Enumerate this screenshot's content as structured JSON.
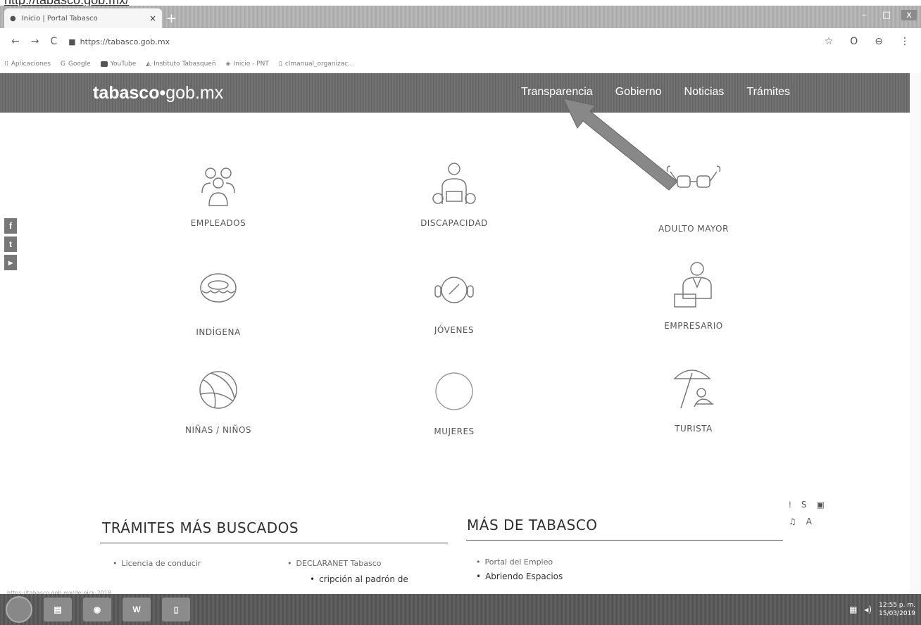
{
  "page_url_caption": "http://tabasco.gob.mx/",
  "browser": {
    "tab_title": "Inicio | Portal Tabasco",
    "new_tab": "+",
    "address": "https://tabasco.gob.mx",
    "bookmarks": [
      "Aplicaciones",
      "Google",
      "YouTube",
      "Instituto Tabasqueñ",
      "Inicio - PNT",
      "clmanual_organizac..."
    ]
  },
  "site": {
    "logo_bold": "tabasco",
    "logo_dot": "•",
    "logo_rest": "gob.mx",
    "nav": [
      "Transparencia",
      "Gobierno",
      "Noticias",
      "Trámites"
    ]
  },
  "social": {
    "facebook": "f",
    "twitter": "t",
    "youtube": "▸"
  },
  "categories": [
    {
      "label": "EMPLEADOS",
      "icon": "people-icon"
    },
    {
      "label": "DISCAPACIDAD",
      "icon": "wheelchair-icon"
    },
    {
      "label": "ADULTO MAYOR",
      "icon": "glasses-icon"
    },
    {
      "label": "INDÍGENA",
      "icon": "drum-icon"
    },
    {
      "label": "JÓVENES",
      "icon": "headphones-icon"
    },
    {
      "label": "EMPRESARIO",
      "icon": "businessman-icon"
    },
    {
      "label": "NIÑAS / NIÑOS",
      "icon": "ball-icon"
    },
    {
      "label": "MUJERES",
      "icon": "circle-icon"
    },
    {
      "label": "TURISTA",
      "icon": "umbrella-icon"
    }
  ],
  "tramites": {
    "title": "TRÁMITES MÁS BUSCADOS",
    "items": [
      "Licencia de conducir",
      "DECLARANET Tabasco",
      "cripción al padrón de"
    ]
  },
  "mas": {
    "title": "MÁS DE TABASCO",
    "items": [
      "Portal del Empleo",
      "Abriendo Espacios"
    ]
  },
  "status_url": "https://tabasco.gob.mx/de-pick-2018",
  "taskbar": {
    "word_label": "W",
    "clock_time": "12:55 p. m.",
    "clock_date": "15/03/2019"
  }
}
